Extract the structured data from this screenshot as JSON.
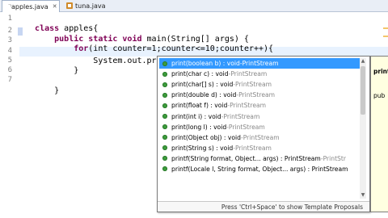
{
  "tabs": [
    {
      "label": "*apples.java",
      "active": true
    },
    {
      "label": "tuna.java",
      "active": false
    }
  ],
  "editor": {
    "line_numbers": [
      "1",
      "2",
      "3",
      "4",
      "5",
      "6",
      "7"
    ],
    "code": [
      {
        "kw": "class",
        "rest": " apples{"
      },
      {
        "kw": "    public static void",
        "rest": " main(String[] args) {"
      },
      {
        "kw": "        for",
        "rest": "(int counter=1;counter<=10;counter++){"
      },
      {
        "kw": "",
        "rest": "            System.out.pr"
      },
      {
        "kw": "",
        "rest": "        }"
      },
      {
        "kw": "",
        "rest": "    }"
      },
      {
        "kw": "",
        "rest": ""
      }
    ]
  },
  "completion": {
    "items": [
      {
        "sig": "print(boolean b) : void",
        "sep": " - ",
        "owner": "PrintStream",
        "selected": true
      },
      {
        "sig": "print(char c) : void",
        "sep": " - ",
        "owner": "PrintStream"
      },
      {
        "sig": "print(char[] s) : void",
        "sep": " - ",
        "owner": "PrintStream"
      },
      {
        "sig": "print(double d) : void",
        "sep": " - ",
        "owner": "PrintStream"
      },
      {
        "sig": "print(float f) : void",
        "sep": " - ",
        "owner": "PrintStream"
      },
      {
        "sig": "print(int i) : void",
        "sep": " - ",
        "owner": "PrintStream"
      },
      {
        "sig": "print(long l) : void",
        "sep": " - ",
        "owner": "PrintStream"
      },
      {
        "sig": "print(Object obj) : void",
        "sep": " - ",
        "owner": "PrintStream"
      },
      {
        "sig": "print(String s) : void",
        "sep": " - ",
        "owner": "PrintStream"
      },
      {
        "sig": "printf(String format, Object... args) : PrintStream",
        "sep": " - ",
        "owner": "PrintStr"
      },
      {
        "sig": "printf(Locale l, String format, Object... args) : PrintStream",
        "sep": "",
        "owner": ""
      }
    ],
    "footer": "Press 'Ctrl+Space' to show Template Proposals"
  },
  "doc": {
    "title": "print",
    "body": "pub"
  },
  "colors": {
    "selection": "#3399ff",
    "method_icon": "#3d9c3d",
    "keyword": "#7f0055"
  }
}
